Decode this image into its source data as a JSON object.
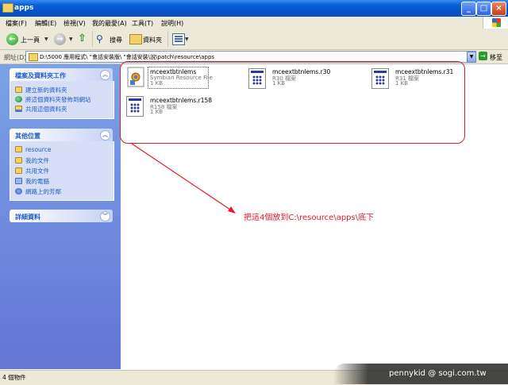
{
  "window": {
    "title": "apps"
  },
  "menu": [
    "檔案(F)",
    "編輯(E)",
    "檢視(V)",
    "我的最愛(A)",
    "工具(T)",
    "說明(H)"
  ],
  "toolbar": {
    "back_label": "上一頁",
    "search_label": "搜尋",
    "folders_label": "資料夾"
  },
  "address": {
    "label": "網址(D)",
    "path": "D:\\5000 應用程式\\ \"會話安裝版\\ \"會話安裝\\說\\patch\\resource\\apps",
    "go_label": "移至"
  },
  "left_pane": {
    "tasks": {
      "title": "檔案及資料夾工作",
      "items": [
        "建立新的資料夾",
        "將這個資料夾發佈到網站",
        "共用這個資料夾"
      ]
    },
    "other_places": {
      "title": "其他位置",
      "items": [
        "resource",
        "我的文件",
        "共用文件",
        "我的電腦",
        "網路上的芳鄰"
      ]
    },
    "details": {
      "title": "詳細資料"
    }
  },
  "files": [
    {
      "name": "mceextbtnlems",
      "type": "Symbian Resource File",
      "size": "1 KB",
      "icon": "gear-file-icon"
    },
    {
      "name": "mceextbtnlems.r30",
      "type": "R30 檔案",
      "size": "1 KB",
      "icon": "grid-file-icon"
    },
    {
      "name": "mceextbtnlems.r31",
      "type": "R31 檔案",
      "size": "1 KB",
      "icon": "grid-file-icon"
    },
    {
      "name": "mceextbtnlems.r158",
      "type": "R158 檔案",
      "size": "1 KB",
      "icon": "grid-file-icon"
    }
  ],
  "annotation": {
    "text": "把這4個放到C:\\resource\\apps\\底下",
    "color": "#e01a2a"
  },
  "status": {
    "text": "4 個物件"
  },
  "watermark": {
    "text": "pennykid @ sogi.com.tw"
  }
}
